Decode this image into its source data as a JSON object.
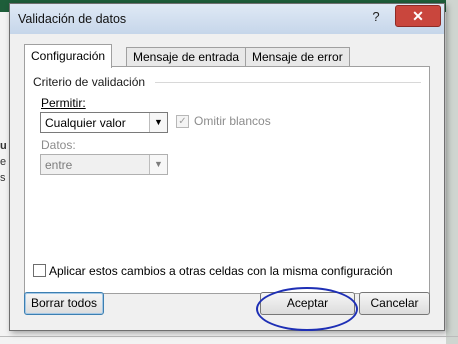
{
  "dialog": {
    "title": "Validación de datos",
    "help_symbol": "?",
    "close_symbol": "✕"
  },
  "tabs": [
    {
      "label": "Configuración",
      "active": true
    },
    {
      "label": "Mensaje de entrada",
      "active": false
    },
    {
      "label": "Mensaje de error",
      "active": false
    }
  ],
  "criteria": {
    "group_label": "Criterio de validación",
    "allow_label": "Permitir:",
    "allow_value": "Cualquier valor",
    "ignore_blanks_label": "Omitir blancos",
    "data_label": "Datos:",
    "data_value": "entre"
  },
  "apply_all": {
    "label": "Aplicar estos cambios a otras celdas con la misma configuración"
  },
  "buttons": {
    "clear_all": "Borrar todos",
    "accept": "Aceptar",
    "cancel": "Cancelar"
  },
  "background": {
    "left_letters": [
      "u",
      "e",
      "s"
    ]
  },
  "colors": {
    "close_button": "#c9463d",
    "annotation_circle": "#1e2fb5"
  }
}
